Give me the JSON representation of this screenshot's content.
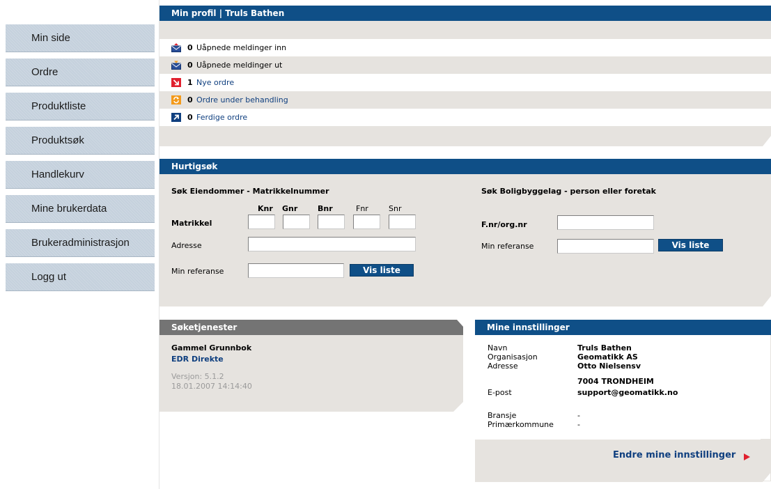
{
  "nav": {
    "items": [
      {
        "label": "Min side"
      },
      {
        "label": "Ordre"
      },
      {
        "label": "Produktliste"
      },
      {
        "label": "Produktsøk"
      },
      {
        "label": "Handlekurv"
      },
      {
        "label": "Mine brukerdata"
      },
      {
        "label": "Brukeradministrasjon"
      },
      {
        "label": "Logg ut"
      }
    ]
  },
  "profile": {
    "title": "Min profil |  Truls Bathen",
    "messages": [
      {
        "icon": "envelope-in-icon",
        "count": "0",
        "label": "Uåpnede meldinger inn"
      },
      {
        "icon": "envelope-out-icon",
        "count": "0",
        "label": "Uåpnede meldinger ut"
      },
      {
        "icon": "new-order-icon",
        "count": "1",
        "label": "Nye ordre"
      },
      {
        "icon": "order-processing-icon",
        "count": "0",
        "label": "Ordre under behandling"
      },
      {
        "icon": "order-finished-icon",
        "count": "0",
        "label": "Ferdige ordre"
      }
    ]
  },
  "quicksearch": {
    "title": "Hurtigsøk",
    "left": {
      "heading": "Søk Eiendommer - Matrikkelnummer",
      "cols": [
        "Knr",
        "Gnr",
        "Bnr",
        "Fnr",
        "Snr"
      ],
      "matrikkel_label": "Matrikkel",
      "adresse_label": "Adresse",
      "ref_label": "Min referanse",
      "button": "Vis liste"
    },
    "right": {
      "heading": "Søk Boligbyggelag - person eller foretak",
      "fnr_label": "F.nr/org.nr",
      "ref_label": "Min referanse",
      "button": "Vis liste"
    }
  },
  "services": {
    "title": "Søketjenester",
    "item1": "Gammel Grunnbok",
    "item2": "EDR Direkte",
    "version": "Versjon: 5.1.2",
    "date": "18.01.2007 14:14:40"
  },
  "settings": {
    "title": "Mine innstillinger",
    "labels": {
      "navn": "Navn",
      "org": "Organisasjon",
      "adresse": "Adresse",
      "epost": "E-post",
      "bransje": "Bransje",
      "kommune": "Primærkommune"
    },
    "values": {
      "navn": "Truls Bathen",
      "org": "Geomatikk AS",
      "adresse1": "Otto Nielsensv",
      "adresse2": "7004  TRONDHEIM",
      "epost": "support@geomatikk.no",
      "bransje": "-",
      "kommune": "-"
    },
    "edit_link": "Endre mine innstillinger"
  },
  "colors": {
    "header_blue": "#0f4f87",
    "panel_gray": "#e6e3df",
    "nav_blue_gray": "#c5d1dd",
    "link_red": "#e0202e"
  }
}
